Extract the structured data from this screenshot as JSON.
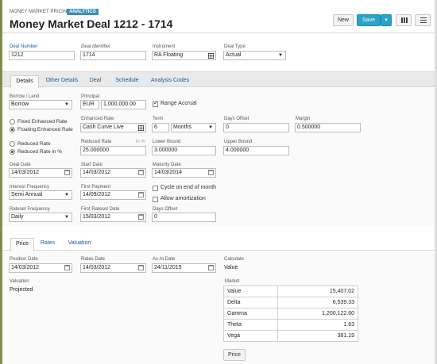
{
  "app": {
    "name": "MONEY MARKET PRICING",
    "badge": "ANALYTICS"
  },
  "title": "Money Market Deal 1212 - 1714",
  "toolbar": {
    "new_label": "New",
    "save_label": "Save",
    "save_arrow": "▾"
  },
  "deal_header": {
    "deal_number": {
      "label": "Deal Number",
      "value": "1212"
    },
    "deal_identifier": {
      "label": "Deal Identifier",
      "value": "1714"
    },
    "instrument": {
      "label": "Instrument",
      "value": "RA Floating"
    },
    "deal_type": {
      "label": "Deal Type",
      "value": "Actual"
    }
  },
  "tabs": [
    "Details",
    "Other Details",
    "Deal",
    "Schedule",
    "Analysis Codes"
  ],
  "details": {
    "borrow_lend": {
      "label": "Borrow / Lend",
      "value": "Borrow"
    },
    "principal": {
      "label": "Principal",
      "currency": "EUR",
      "value": "1,000,000.00"
    },
    "range_accrual": {
      "label": "Range Accrual",
      "checked": true
    },
    "rate_options": [
      "Fixed Enhanced Rate",
      "Floating Enhanced Rate"
    ],
    "enhanced_rate": {
      "label": "Enhanced Rate",
      "value": "Cash Curve Live"
    },
    "term": {
      "label": "Term",
      "value": "6",
      "unit": "Months"
    },
    "days_offset": {
      "label": "Days Offset",
      "value": "0"
    },
    "margin": {
      "label": "Margin",
      "value": "0.500000"
    },
    "reduced_options": [
      "Reduced Rate",
      "Reduced Rate in %"
    ],
    "reduced_rate": {
      "label": "Reduced Rate",
      "unit_hint": "in %",
      "value": "25.000000"
    },
    "lower_bound": {
      "label": "Lower Bound",
      "value": "3.000000"
    },
    "upper_bound": {
      "label": "Upper Bound",
      "value": "4.000000"
    },
    "deal_date": {
      "label": "Deal Date",
      "value": "14/03/2012"
    },
    "start_date": {
      "label": "Start Date",
      "value": "14/03/2012"
    },
    "maturity_date": {
      "label": "Maturity Date",
      "value": "14/03/2014"
    },
    "interest_frequency": {
      "label": "Interest Frequency",
      "value": "Semi Annual"
    },
    "first_payment": {
      "label": "First Payment",
      "value": "14/09/2012"
    },
    "cycle_end_of_month": {
      "label": "Cycle on end of month",
      "checked": false
    },
    "allow_amortization": {
      "label": "Allow amortization",
      "checked": false
    },
    "rateset_frequency": {
      "label": "Rateset Frequency",
      "value": "Daily"
    },
    "first_rateset_date": {
      "label": "First Rateset Date",
      "value": "15/03/2012"
    },
    "days_offset_2": {
      "label": "Days Offset",
      "value": "0"
    }
  },
  "price_tabs": [
    "Price",
    "Rates",
    "Valuation"
  ],
  "price": {
    "position_date": {
      "label": "Position Date",
      "value": "14/03/2012"
    },
    "rates_date": {
      "label": "Rates Date",
      "value": "14/03/2012"
    },
    "as_at_date": {
      "label": "As At Date",
      "value": "24/11/2015"
    },
    "calculate": {
      "label": "Calculate",
      "value": "Value"
    },
    "valuation": {
      "label": "Valuation",
      "value": "Projected"
    },
    "market": {
      "label": "Market",
      "rows": [
        {
          "name": "Value",
          "value": "15,407.02"
        },
        {
          "name": "Delta",
          "value": "6,539.33"
        },
        {
          "name": "Gamma",
          "value": "1,200,122.60"
        },
        {
          "name": "Theta",
          "value": "1.63"
        },
        {
          "name": "Vega",
          "value": "381.19"
        }
      ]
    },
    "price_button": "Price"
  }
}
